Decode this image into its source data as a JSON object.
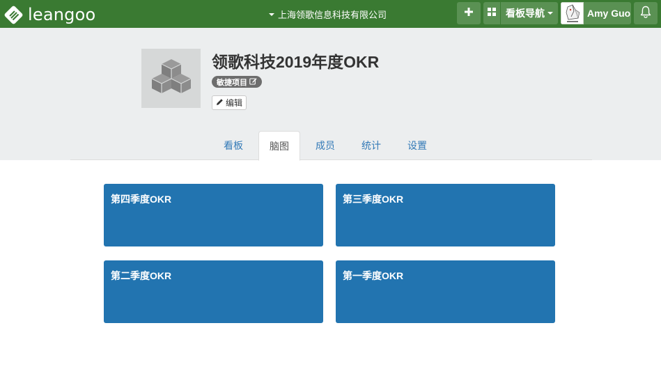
{
  "topbar": {
    "brand": "leangoo",
    "organization": "上海领歌信息科技有限公司",
    "add_icon": "plus-icon",
    "grid_icon": "grid-icon",
    "board_nav_label": "看板导航",
    "user_name": "Amy Guo",
    "bell_icon": "bell-icon",
    "brand_color": "#3a7a32"
  },
  "project": {
    "title": "领歌科技2019年度OKR",
    "tag": "敏捷项目",
    "edit_label": "编辑",
    "thumbnail_icon": "cubes-icon"
  },
  "tabs": [
    {
      "label": "看板",
      "active": false
    },
    {
      "label": "脑图",
      "active": true
    },
    {
      "label": "成员",
      "active": false
    },
    {
      "label": "统计",
      "active": false
    },
    {
      "label": "设置",
      "active": false
    }
  ],
  "cards": [
    {
      "title": "第四季度OKR"
    },
    {
      "title": "第三季度OKR"
    },
    {
      "title": "第二季度OKR"
    },
    {
      "title": "第一季度OKR"
    }
  ],
  "colors": {
    "card": "#2274b0",
    "tab_link": "#337ab7",
    "header_bg": "#eceeef"
  }
}
